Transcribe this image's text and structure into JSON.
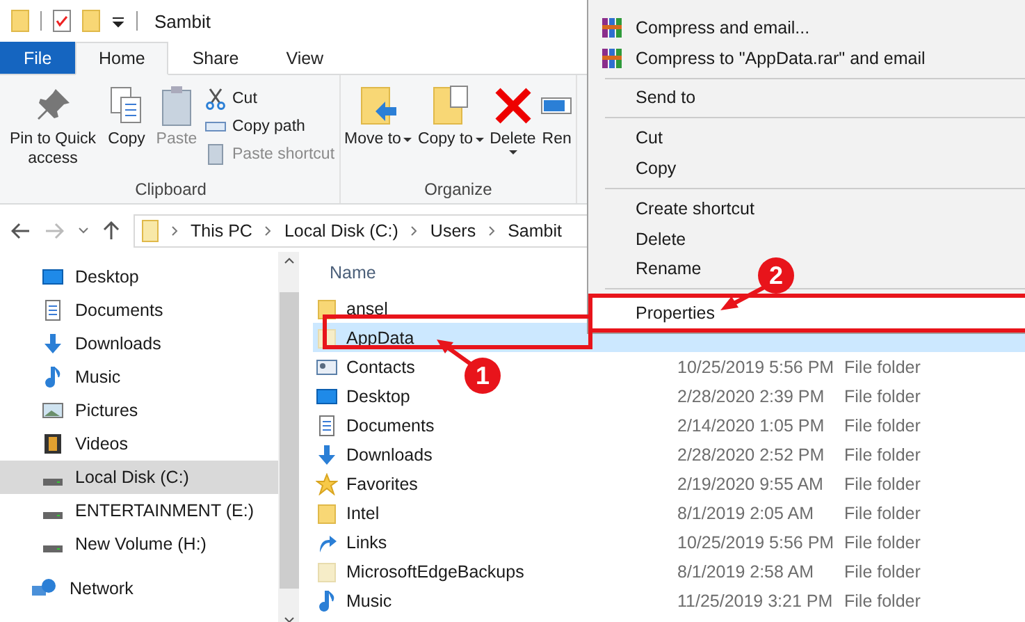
{
  "window": {
    "title": "Sambit"
  },
  "ribbon_tabs": [
    {
      "label": "File",
      "kind": "file",
      "selected": false
    },
    {
      "label": "Home",
      "kind": "tab",
      "selected": true
    },
    {
      "label": "Share",
      "kind": "tab",
      "selected": false
    },
    {
      "label": "View",
      "kind": "tab",
      "selected": false
    }
  ],
  "ribbon_groups": [
    {
      "label": "Clipboard",
      "buttons": [
        {
          "label": "Pin to Quick access",
          "kind": "large",
          "disabled": false
        },
        {
          "label": "Copy",
          "kind": "large",
          "disabled": false
        },
        {
          "label": "Paste",
          "kind": "large",
          "disabled": true
        },
        {
          "label": "Cut",
          "kind": "small",
          "disabled": false
        },
        {
          "label": "Copy path",
          "kind": "small",
          "disabled": false
        },
        {
          "label": "Paste shortcut",
          "kind": "small",
          "disabled": true
        }
      ]
    },
    {
      "label": "Organize",
      "buttons": [
        {
          "label": "Move to",
          "kind": "dropdown",
          "disabled": false
        },
        {
          "label": "Copy to",
          "kind": "dropdown",
          "disabled": false
        },
        {
          "label": "Delete",
          "kind": "splitdrop",
          "disabled": false
        },
        {
          "label": "Ren",
          "kind": "large",
          "disabled": false
        }
      ]
    }
  ],
  "address": {
    "crumbs": [
      "This PC",
      "Local Disk (C:)",
      "Users",
      "Sambit"
    ]
  },
  "sidebar": {
    "items": [
      {
        "label": "Desktop",
        "kind": "desktop",
        "selected": false
      },
      {
        "label": "Documents",
        "kind": "documents",
        "selected": false
      },
      {
        "label": "Downloads",
        "kind": "downloads",
        "selected": false
      },
      {
        "label": "Music",
        "kind": "music",
        "selected": false
      },
      {
        "label": "Pictures",
        "kind": "pictures",
        "selected": false
      },
      {
        "label": "Videos",
        "kind": "videos",
        "selected": false
      },
      {
        "label": "Local Disk (C:)",
        "kind": "drive",
        "selected": true
      },
      {
        "label": "ENTERTAINMENT (E:)",
        "kind": "drive",
        "selected": false
      },
      {
        "label": "New Volume (H:)",
        "kind": "drive",
        "selected": false
      },
      {
        "label": "Network",
        "kind": "network",
        "selected": false
      }
    ]
  },
  "file_list": {
    "columns": [
      "Name"
    ],
    "rows": [
      {
        "name": "ansel",
        "kind": "folder",
        "selected": false
      },
      {
        "name": "AppData",
        "kind": "hidden",
        "selected": true
      },
      {
        "name": "Contacts",
        "kind": "contacts",
        "date": "10/25/2019 5:56 PM",
        "type": "File folder",
        "selected": false
      },
      {
        "name": "Desktop",
        "kind": "desktop",
        "date": "2/28/2020 2:39 PM",
        "type": "File folder",
        "selected": false
      },
      {
        "name": "Documents",
        "kind": "documents",
        "date": "2/14/2020 1:05 PM",
        "type": "File folder",
        "selected": false
      },
      {
        "name": "Downloads",
        "kind": "downloads",
        "date": "2/28/2020 2:52 PM",
        "type": "File folder",
        "selected": false
      },
      {
        "name": "Favorites",
        "kind": "star",
        "date": "2/19/2020 9:55 AM",
        "type": "File folder",
        "selected": false
      },
      {
        "name": "Intel",
        "kind": "folder",
        "date": "8/1/2019 2:05 AM",
        "type": "File folder",
        "selected": false
      },
      {
        "name": "Links",
        "kind": "links",
        "date": "10/25/2019 5:56 PM",
        "type": "File folder",
        "selected": false
      },
      {
        "name": "MicrosoftEdgeBackups",
        "kind": "hidden",
        "date": "8/1/2019 2:58 AM",
        "type": "File folder",
        "selected": false
      },
      {
        "name": "Music",
        "kind": "music",
        "date": "11/25/2019 3:21 PM",
        "type": "File folder",
        "selected": false
      }
    ]
  },
  "context_menu": {
    "items": [
      {
        "kind": "archive",
        "label": "Compress and email..."
      },
      {
        "kind": "archive",
        "label": "Compress to \"AppData.rar\" and email"
      },
      {
        "kind": "separator"
      },
      {
        "kind": "item",
        "label": "Send to",
        "framed": false
      },
      {
        "kind": "separator"
      },
      {
        "kind": "item",
        "label": "Cut",
        "framed": false
      },
      {
        "kind": "item",
        "label": "Copy",
        "framed": false
      },
      {
        "kind": "separator"
      },
      {
        "kind": "item",
        "label": "Create shortcut",
        "framed": false
      },
      {
        "kind": "item",
        "label": "Delete",
        "framed": false
      },
      {
        "kind": "item",
        "label": "Rename",
        "framed": false
      },
      {
        "kind": "separator"
      },
      {
        "kind": "item",
        "label": "Properties",
        "framed": true
      }
    ]
  },
  "annotations": [
    {
      "label": "1"
    },
    {
      "label": "2"
    }
  ]
}
